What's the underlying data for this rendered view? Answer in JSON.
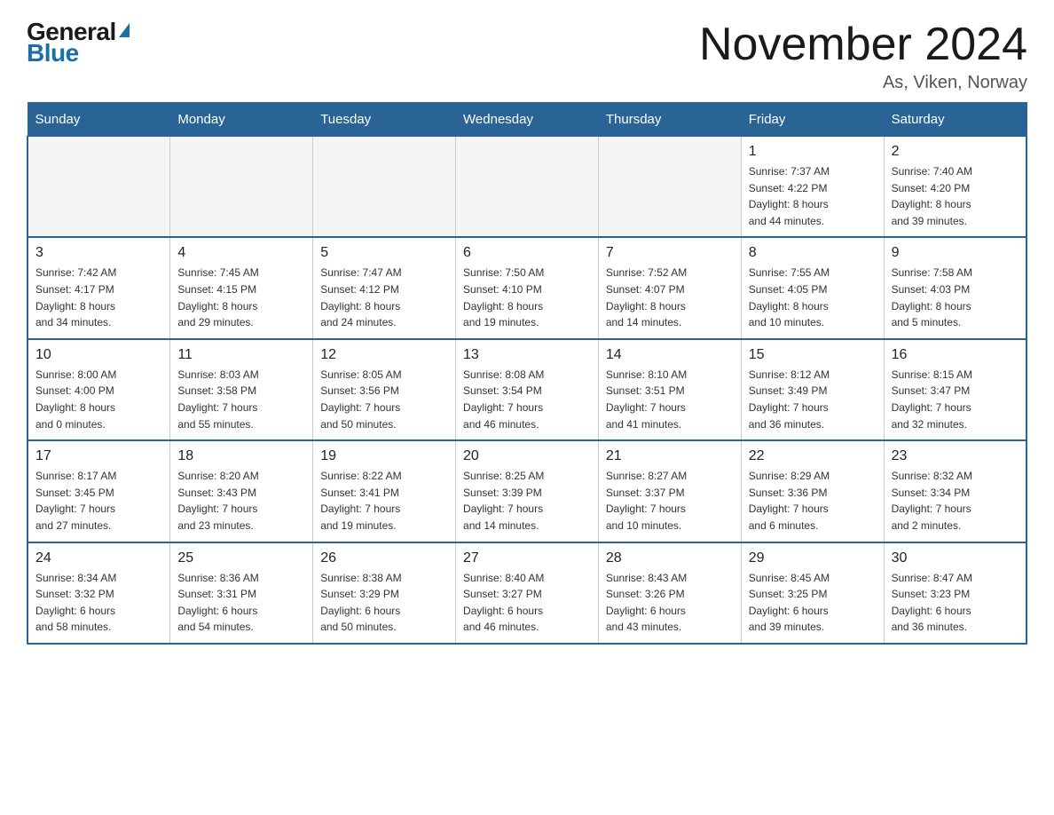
{
  "header": {
    "logo_general": "General",
    "logo_blue": "Blue",
    "month_title": "November 2024",
    "location": "As, Viken, Norway"
  },
  "weekdays": [
    "Sunday",
    "Monday",
    "Tuesday",
    "Wednesday",
    "Thursday",
    "Friday",
    "Saturday"
  ],
  "rows": [
    [
      {
        "day": "",
        "info": ""
      },
      {
        "day": "",
        "info": ""
      },
      {
        "day": "",
        "info": ""
      },
      {
        "day": "",
        "info": ""
      },
      {
        "day": "",
        "info": ""
      },
      {
        "day": "1",
        "info": "Sunrise: 7:37 AM\nSunset: 4:22 PM\nDaylight: 8 hours\nand 44 minutes."
      },
      {
        "day": "2",
        "info": "Sunrise: 7:40 AM\nSunset: 4:20 PM\nDaylight: 8 hours\nand 39 minutes."
      }
    ],
    [
      {
        "day": "3",
        "info": "Sunrise: 7:42 AM\nSunset: 4:17 PM\nDaylight: 8 hours\nand 34 minutes."
      },
      {
        "day": "4",
        "info": "Sunrise: 7:45 AM\nSunset: 4:15 PM\nDaylight: 8 hours\nand 29 minutes."
      },
      {
        "day": "5",
        "info": "Sunrise: 7:47 AM\nSunset: 4:12 PM\nDaylight: 8 hours\nand 24 minutes."
      },
      {
        "day": "6",
        "info": "Sunrise: 7:50 AM\nSunset: 4:10 PM\nDaylight: 8 hours\nand 19 minutes."
      },
      {
        "day": "7",
        "info": "Sunrise: 7:52 AM\nSunset: 4:07 PM\nDaylight: 8 hours\nand 14 minutes."
      },
      {
        "day": "8",
        "info": "Sunrise: 7:55 AM\nSunset: 4:05 PM\nDaylight: 8 hours\nand 10 minutes."
      },
      {
        "day": "9",
        "info": "Sunrise: 7:58 AM\nSunset: 4:03 PM\nDaylight: 8 hours\nand 5 minutes."
      }
    ],
    [
      {
        "day": "10",
        "info": "Sunrise: 8:00 AM\nSunset: 4:00 PM\nDaylight: 8 hours\nand 0 minutes."
      },
      {
        "day": "11",
        "info": "Sunrise: 8:03 AM\nSunset: 3:58 PM\nDaylight: 7 hours\nand 55 minutes."
      },
      {
        "day": "12",
        "info": "Sunrise: 8:05 AM\nSunset: 3:56 PM\nDaylight: 7 hours\nand 50 minutes."
      },
      {
        "day": "13",
        "info": "Sunrise: 8:08 AM\nSunset: 3:54 PM\nDaylight: 7 hours\nand 46 minutes."
      },
      {
        "day": "14",
        "info": "Sunrise: 8:10 AM\nSunset: 3:51 PM\nDaylight: 7 hours\nand 41 minutes."
      },
      {
        "day": "15",
        "info": "Sunrise: 8:12 AM\nSunset: 3:49 PM\nDaylight: 7 hours\nand 36 minutes."
      },
      {
        "day": "16",
        "info": "Sunrise: 8:15 AM\nSunset: 3:47 PM\nDaylight: 7 hours\nand 32 minutes."
      }
    ],
    [
      {
        "day": "17",
        "info": "Sunrise: 8:17 AM\nSunset: 3:45 PM\nDaylight: 7 hours\nand 27 minutes."
      },
      {
        "day": "18",
        "info": "Sunrise: 8:20 AM\nSunset: 3:43 PM\nDaylight: 7 hours\nand 23 minutes."
      },
      {
        "day": "19",
        "info": "Sunrise: 8:22 AM\nSunset: 3:41 PM\nDaylight: 7 hours\nand 19 minutes."
      },
      {
        "day": "20",
        "info": "Sunrise: 8:25 AM\nSunset: 3:39 PM\nDaylight: 7 hours\nand 14 minutes."
      },
      {
        "day": "21",
        "info": "Sunrise: 8:27 AM\nSunset: 3:37 PM\nDaylight: 7 hours\nand 10 minutes."
      },
      {
        "day": "22",
        "info": "Sunrise: 8:29 AM\nSunset: 3:36 PM\nDaylight: 7 hours\nand 6 minutes."
      },
      {
        "day": "23",
        "info": "Sunrise: 8:32 AM\nSunset: 3:34 PM\nDaylight: 7 hours\nand 2 minutes."
      }
    ],
    [
      {
        "day": "24",
        "info": "Sunrise: 8:34 AM\nSunset: 3:32 PM\nDaylight: 6 hours\nand 58 minutes."
      },
      {
        "day": "25",
        "info": "Sunrise: 8:36 AM\nSunset: 3:31 PM\nDaylight: 6 hours\nand 54 minutes."
      },
      {
        "day": "26",
        "info": "Sunrise: 8:38 AM\nSunset: 3:29 PM\nDaylight: 6 hours\nand 50 minutes."
      },
      {
        "day": "27",
        "info": "Sunrise: 8:40 AM\nSunset: 3:27 PM\nDaylight: 6 hours\nand 46 minutes."
      },
      {
        "day": "28",
        "info": "Sunrise: 8:43 AM\nSunset: 3:26 PM\nDaylight: 6 hours\nand 43 minutes."
      },
      {
        "day": "29",
        "info": "Sunrise: 8:45 AM\nSunset: 3:25 PM\nDaylight: 6 hours\nand 39 minutes."
      },
      {
        "day": "30",
        "info": "Sunrise: 8:47 AM\nSunset: 3:23 PM\nDaylight: 6 hours\nand 36 minutes."
      }
    ]
  ]
}
